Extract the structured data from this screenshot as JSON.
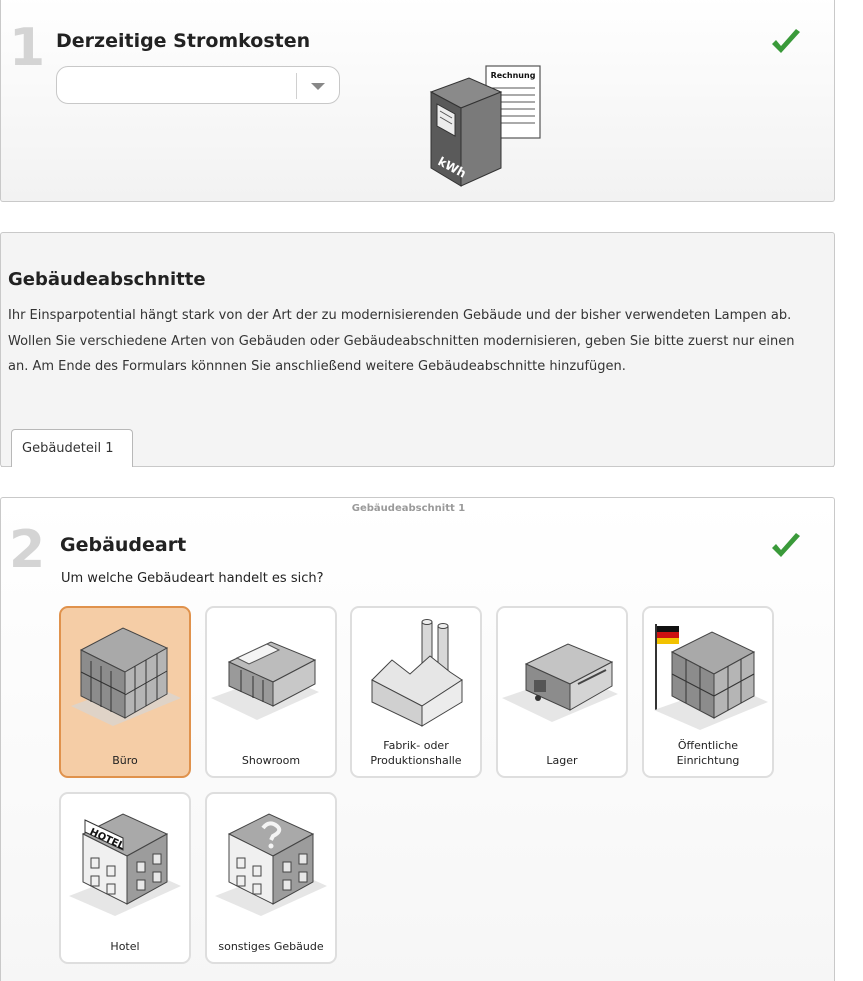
{
  "colors": {
    "check": "#3a9a3a",
    "selected_bg": "#f5cda6",
    "selected_border": "#e0924c"
  },
  "step1": {
    "number": "1",
    "title": "Derzeitige Stromkosten",
    "select_value": "",
    "illustration": {
      "label_invoice": "Rechnung",
      "label_meter": "kWh"
    }
  },
  "buildings_section": {
    "title": "Gebäudeabschnitte",
    "description": "Ihr Einsparpotential hängt stark von der Art der zu modernisierenden Gebäude und der bisher verwendeten Lampen ab. Wollen Sie verschiedene Arten von Gebäuden oder Gebäudeabschnitten modernisieren, geben Sie bitte zuerst nur einen an. Am Ende des Formulars könnnen Sie anschließend weitere Gebäudeabschnitte hinzufügen.",
    "tab_label": "Gebäudeteil 1"
  },
  "step2": {
    "caption": "Gebäudeabschnitt 1",
    "number": "2",
    "title": "Gebäudeart",
    "question": "Um welche Gebäudeart handelt es sich?",
    "options": [
      {
        "label": "Büro",
        "icon": "office-building-icon",
        "selected": true
      },
      {
        "label": "Showroom",
        "icon": "showroom-icon",
        "selected": false
      },
      {
        "label": "Fabrik- oder\nProduktionshalle",
        "icon": "factory-icon",
        "selected": false
      },
      {
        "label": "Lager",
        "icon": "warehouse-icon",
        "selected": false
      },
      {
        "label": "Öffentliche\nEinrichtung",
        "icon": "public-building-icon",
        "selected": false
      },
      {
        "label": "Hotel",
        "icon": "hotel-icon",
        "hotel_sign": "HOTEL",
        "selected": false
      },
      {
        "label": "sonstiges Gebäude",
        "icon": "other-building-icon",
        "selected": false
      }
    ]
  }
}
